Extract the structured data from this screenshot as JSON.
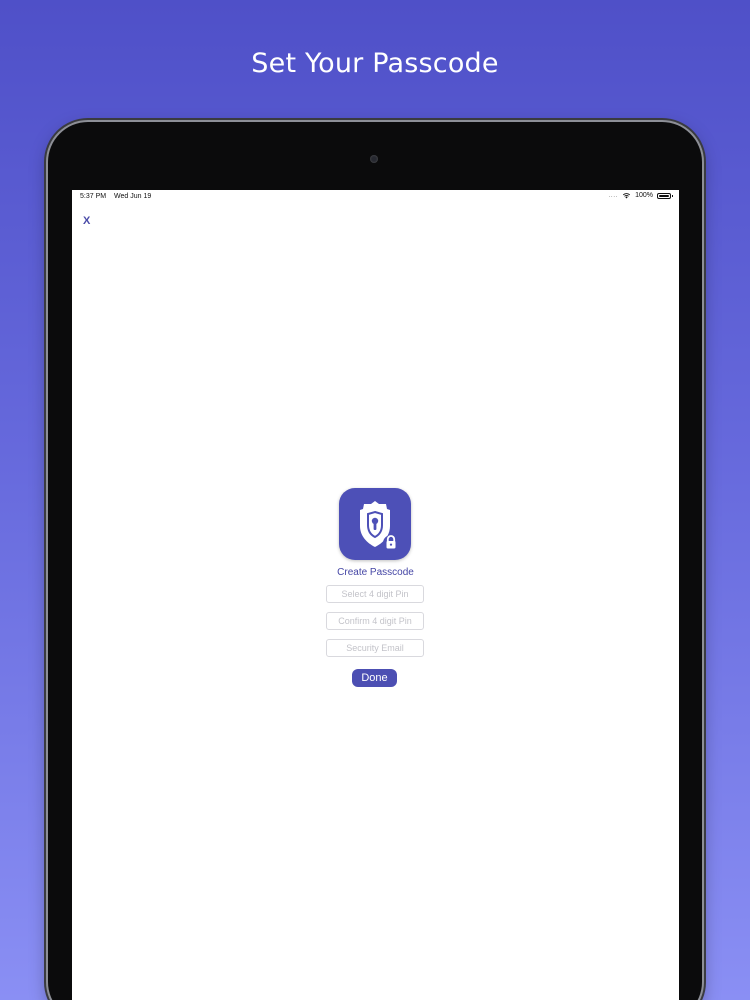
{
  "promo": {
    "title": "Set Your Passcode"
  },
  "status_bar": {
    "time": "5:37 PM",
    "date": "Wed Jun 19",
    "signal_dots": "....",
    "battery": "100%"
  },
  "nav": {
    "close_label": "X"
  },
  "form": {
    "heading": "Create Passcode",
    "pin_placeholder": "Select 4 digit Pin",
    "confirm_placeholder": "Confirm 4 digit Pin",
    "email_placeholder": "Security Email",
    "done_label": "Done"
  },
  "icons": {
    "app": "shield-lock-icon",
    "wifi": "wifi-icon",
    "battery": "battery-icon"
  },
  "colors": {
    "accent": "#4c4fb3",
    "background_top": "#4f50c8",
    "background_bottom": "#8a8ff4"
  }
}
